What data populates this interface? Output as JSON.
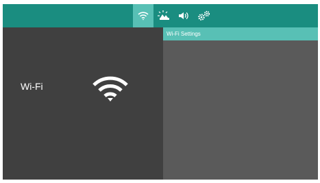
{
  "tabs": [
    {
      "name": "wifi",
      "icon": "wifi-icon",
      "active": true
    },
    {
      "name": "display",
      "icon": "brightness-icon",
      "active": false
    },
    {
      "name": "sound",
      "icon": "speaker-icon",
      "active": false
    },
    {
      "name": "settings",
      "icon": "gears-icon",
      "active": false
    }
  ],
  "left_panel": {
    "label": "Wi-Fi",
    "icon": "wifi-icon"
  },
  "right_panel": {
    "header": "Wi-Fi Settings"
  },
  "colors": {
    "topbar": "#1a8d80",
    "accent": "#58c0b5",
    "left_bg": "#404040",
    "right_bg": "#5a5a5a"
  }
}
